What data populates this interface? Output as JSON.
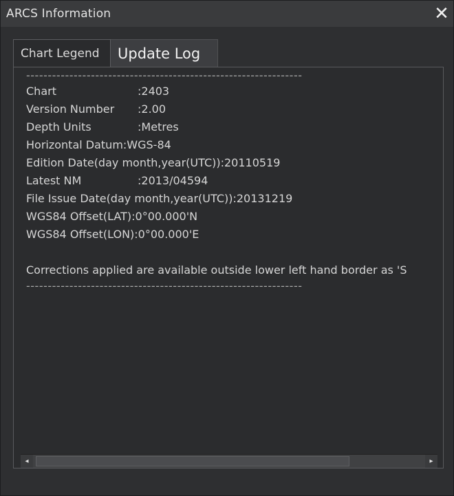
{
  "window": {
    "title": "ARCS Information",
    "close_glyph": "✕"
  },
  "tabs": [
    {
      "label": "Chart Legend",
      "active": true
    },
    {
      "label": "Update Log",
      "active": false
    }
  ],
  "content": {
    "separator": "----------------------------------------------------------------",
    "fields": [
      {
        "label": "Chart",
        "value": ":2403"
      },
      {
        "label": "Version Number",
        "value": ":2.00"
      },
      {
        "label": "Depth Units",
        "value": ":Metres"
      },
      {
        "label": "Horizontal Datum",
        "value": ":WGS-84"
      }
    ],
    "edition_date": "Edition Date(day month,year(UTC)):20110519",
    "latest_nm": {
      "label": "Latest NM",
      "value": ":2013/04594"
    },
    "file_issue_date": "File Issue Date(day month,year(UTC)):20131219",
    "wgs84_lat": "WGS84 Offset(LAT):0°00.000'N",
    "wgs84_lon": "WGS84 Offset(LON):0°00.000'E",
    "corrections": "Corrections applied are available outside lower left hand border as 'S"
  },
  "scrollbar": {
    "left_glyph": "◂",
    "right_glyph": "▸"
  }
}
